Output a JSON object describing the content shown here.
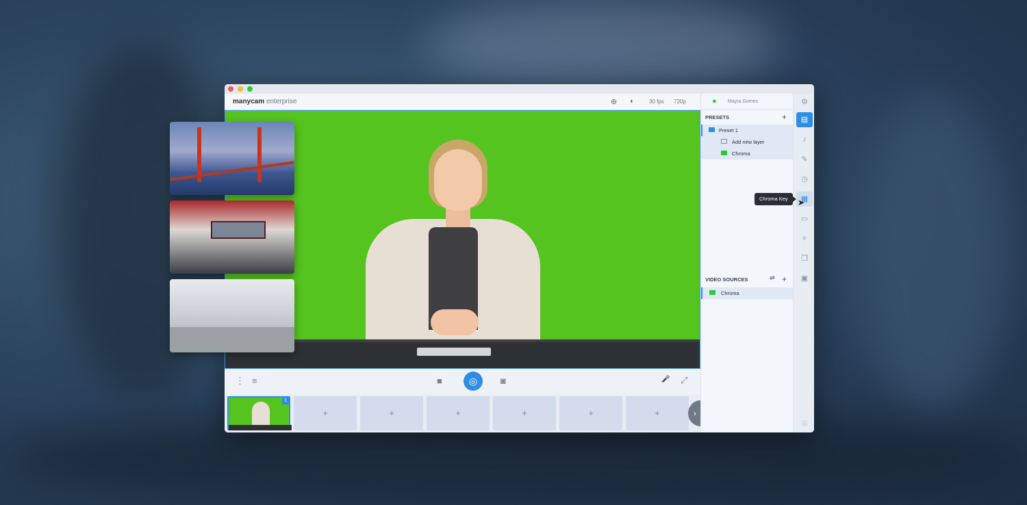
{
  "app": {
    "brand_bold": "manycam",
    "brand_light": " enterprise",
    "fps": "30 fps",
    "resolution": "720p",
    "user": "Mayra Gomes"
  },
  "external_sources": [
    {
      "icon": "bridge-image"
    },
    {
      "icon": "news-studio-image"
    },
    {
      "icon": "office-image"
    }
  ],
  "presets": {
    "title": "PRESETS",
    "add": "+",
    "items": [
      {
        "label": "Preset 1",
        "icon": "preset-icon",
        "color": "#2f8de4"
      },
      {
        "label": "Add new layer",
        "icon": "add-layer-icon",
        "color": "#7a8491"
      },
      {
        "label": "Chroma",
        "icon": "image-icon",
        "color": "#2cc841"
      }
    ]
  },
  "video_sources": {
    "title": "VIDEO SOURCES",
    "add": "+",
    "items": [
      {
        "label": "Chroma",
        "icon": "image-icon",
        "color": "#2cc841"
      }
    ]
  },
  "controls": {
    "menu_icon": "⋮",
    "playlist_icon": "≡",
    "camera_icon": "■",
    "live_icon": "◎",
    "snapshot_icon": "◙",
    "mic_icon": "🎤",
    "fullscreen_icon": "⤢"
  },
  "slots": {
    "active_number": "1",
    "empty_label": "+",
    "next": "›"
  },
  "tooltip": "Chroma Key",
  "colors": {
    "accent": "#2f8de4",
    "chroma_green": "#56c41f"
  }
}
